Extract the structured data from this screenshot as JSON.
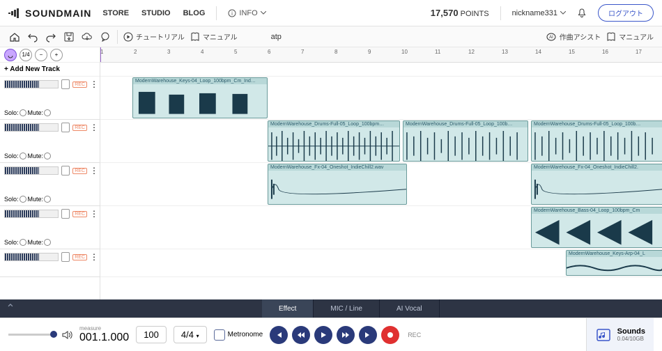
{
  "header": {
    "logo": "SOUNDMAIN",
    "nav": [
      "STORE",
      "STUDIO",
      "BLOG"
    ],
    "info": "INFO",
    "points_value": "17,570",
    "points_label": "POINTS",
    "nickname": "nickname331",
    "logout": "ログアウト"
  },
  "toolbar": {
    "tutorial": "チュートリアル",
    "manual": "マニュアル",
    "song_name": "atp",
    "ai_assist": "作曲アシスト",
    "manual2": "マニュアル"
  },
  "sidebar": {
    "quantize": "1/4",
    "add_track": "+ Add New Track",
    "solo": "Solo:",
    "mute": "Mute:",
    "rec": "REC"
  },
  "ruler": [
    1,
    2,
    3,
    4,
    5,
    6,
    7,
    8,
    9,
    10,
    11,
    12,
    13,
    14,
    15,
    16,
    17
  ],
  "clips": {
    "keys": "ModernWarehouse_Keys-04_Loop_100bpm_Cm_Ind…",
    "drums1": "ModernWarehouse_Drums-Full-05_Loop_100bpm…",
    "drums2": "ModernWarehouse_Drums-Full-05_Loop_100b…",
    "drums3": "ModernWarehouse_Drums-Full-05_Loop_100b…",
    "fx1": "ModernWarehouse_Fx-04_Oneshot_IndieChill2.wav",
    "fx2": "ModernWarehouse_Fx-04_Oneshot_IndieChill2.",
    "bass": "ModernWarehouse_Bass-04_Loop_100bpm_Cm",
    "arp": "ModernWarehouse_Keys-Arp-04_L"
  },
  "bottom_tabs": {
    "effect": "Effect",
    "mic": "MIC / Line",
    "ai_vocal": "AI Vocal"
  },
  "transport": {
    "measure_label": "measure",
    "measure_value": "001.1.000",
    "bpm": "100",
    "timesig": "4/4",
    "metronome": "Metronome",
    "rec": "REC"
  },
  "sounds": {
    "title": "Sounds",
    "usage": "0.04/10GB"
  }
}
